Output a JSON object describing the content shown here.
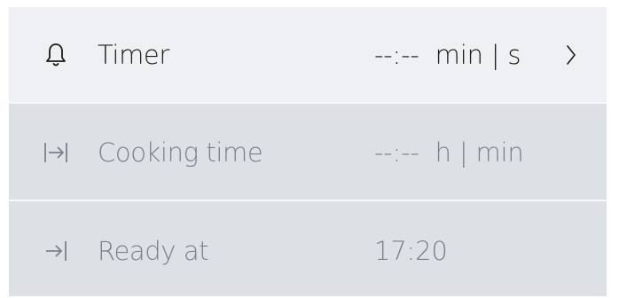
{
  "rows": [
    {
      "icon": "bell-icon",
      "label": "Timer",
      "value": "--:--  min | s",
      "has_chevron": true,
      "enabled": true
    },
    {
      "icon": "duration-icon",
      "label": "Cooking time",
      "value": "--:--  h | min",
      "has_chevron": false,
      "enabled": false
    },
    {
      "icon": "end-time-icon",
      "label": "Ready at",
      "value": "17:20",
      "has_chevron": false,
      "enabled": false
    }
  ],
  "colors": {
    "active_row_bg": "#eef0f3",
    "disabled_row_bg": "#dde1e6",
    "active_text": "#1a1a1a",
    "disabled_text": "#7c8088",
    "divider": "#f7f8f9"
  }
}
